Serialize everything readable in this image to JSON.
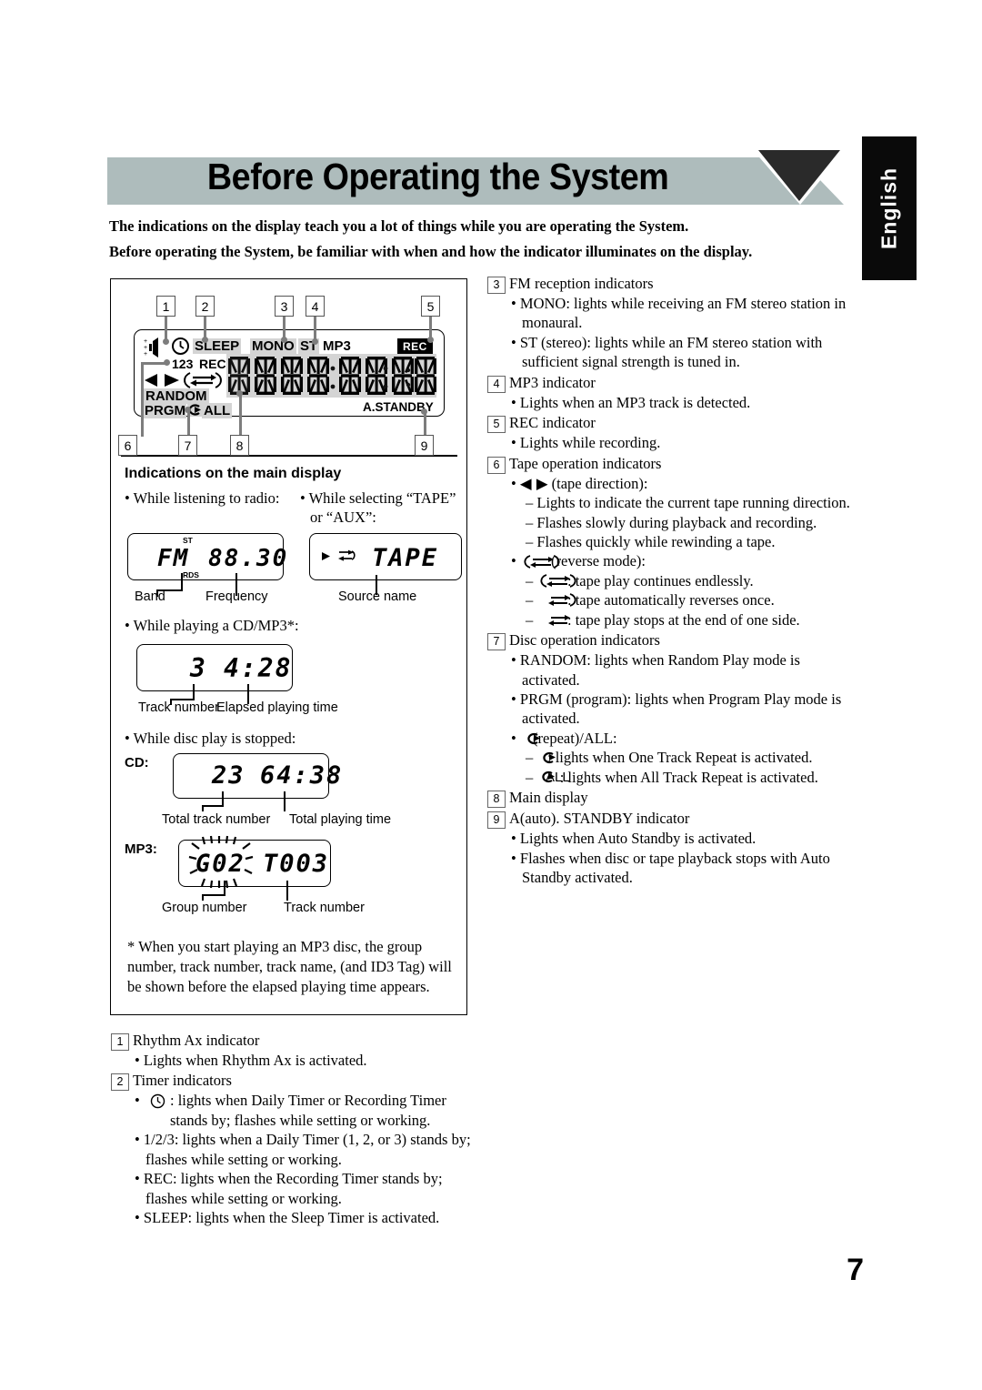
{
  "header": {
    "title": "Before Operating the System",
    "lang_tab": "English",
    "banner_color": "#aebcbc"
  },
  "intro": {
    "line1": "The indications on the display teach you a lot of things while you are operating the System.",
    "line2": "Before operating the System, be familiar with when and how the indicator illuminates on the display."
  },
  "display_diagram": {
    "callouts": [
      "1",
      "2",
      "3",
      "4",
      "5",
      "6",
      "7",
      "8",
      "9"
    ],
    "lcd_labels": {
      "sleep": "SLEEP",
      "mono": "MONO",
      "st": "ST",
      "mp3": "MP3",
      "rec_badge": "REC",
      "timer_numbers": "123",
      "timer_rec": "REC",
      "random": "RANDOM",
      "prgm": "PRGM",
      "all": "ALL",
      "a_standby": "A.STANDBY"
    }
  },
  "main_display_section": {
    "title": "Indications on the main display",
    "radio": {
      "bullet": "• While listening to radio:",
      "lcd_st": "ST",
      "lcd_rds": "RDS",
      "lcd_band": "FM",
      "lcd_freq": "88.30",
      "caption_band": "Band",
      "caption_freq": "Frequency"
    },
    "tape": {
      "bullet_line1": "• While selecting “TAPE”",
      "bullet_line2": "or “AUX”:",
      "lcd_text": "TAPE",
      "caption": "Source name"
    },
    "cdmp3_playing": {
      "bullet": "• While playing a CD/MP3*:",
      "lcd_track": "3",
      "lcd_time": "4:28",
      "caption_track": "Track number",
      "caption_time": "Elapsed playing time"
    },
    "stopped": {
      "bullet": "• While disc play is stopped:",
      "cd_label": "CD:",
      "cd_total_tracks": "23",
      "cd_total_time": "64:38",
      "cd_caption_tracks": "Total track number",
      "cd_caption_time": "Total playing time",
      "mp3_label": "MP3:",
      "mp3_group": "G02",
      "mp3_track": "T003",
      "mp3_caption_group": "Group number",
      "mp3_caption_track": "Track number"
    },
    "footnote": "* When you start playing an MP3 disc, the group number, track number, track name, (and ID3 Tag) will be shown before the elapsed playing time appears."
  },
  "right_items": {
    "i3": {
      "num": "3",
      "title": "FM reception indicators",
      "b1": "• MONO: lights while receiving an FM stereo station in monaural.",
      "b2": "• ST (stereo): lights while an FM stereo station with sufficient signal strength is tuned in."
    },
    "i4": {
      "num": "4",
      "title": "MP3 indicator",
      "b1": "• Lights when an MP3 track is detected."
    },
    "i5": {
      "num": "5",
      "title": "REC indicator",
      "b1": "• Lights while recording."
    },
    "i6": {
      "num": "6",
      "title": "Tape operation indicators",
      "b1_prefix": "•",
      "b1_icons": "◀ ▶",
      "b1_text": "(tape direction):",
      "d1": "– Lights to indicate the current tape running direction.",
      "d2": "– Flashes slowly during playback and recording.",
      "d3": "– Flashes quickly while rewinding a tape.",
      "b2_text": "(reverse mode):",
      "d4": ": tape play continues endlessly.",
      "d5": ": tape automatically reverses once.",
      "d6": ": tape play stops at the end of one side."
    },
    "i7": {
      "num": "7",
      "title": "Disc operation indicators",
      "b1": "• RANDOM: lights when Random Play mode is activated.",
      "b2": "• PRGM (program): lights when Program Play mode is activated.",
      "b3_text": "(repeat)/ALL:",
      "d1": ": lights when One Track Repeat is activated.",
      "d2_all": "ALL",
      "d2": ": lights when All Track Repeat is activated."
    },
    "i8": {
      "num": "8",
      "title": "Main display"
    },
    "i9": {
      "num": "9",
      "title": "A(auto). STANDBY indicator",
      "b1": "• Lights when Auto Standby is activated.",
      "b2": "• Flashes when disc or tape playback stops with Auto Standby activated."
    }
  },
  "bottom_items": {
    "i1": {
      "num": "1",
      "title": "Rhythm Ax indicator",
      "b1": "• Lights when Rhythm Ax is activated."
    },
    "i2": {
      "num": "2",
      "title": "Timer indicators",
      "b1": ": lights when Daily Timer or Recording Timer stands by; flashes while setting or working.",
      "b2": "• 1/2/3: lights when a Daily Timer (1, 2, or 3) stands by; flashes while setting or working.",
      "b3": "• REC: lights when the Recording Timer stands by; flashes while setting or working.",
      "b4": "• SLEEP: lights when the Sleep Timer is activated."
    }
  },
  "page_number": "7"
}
